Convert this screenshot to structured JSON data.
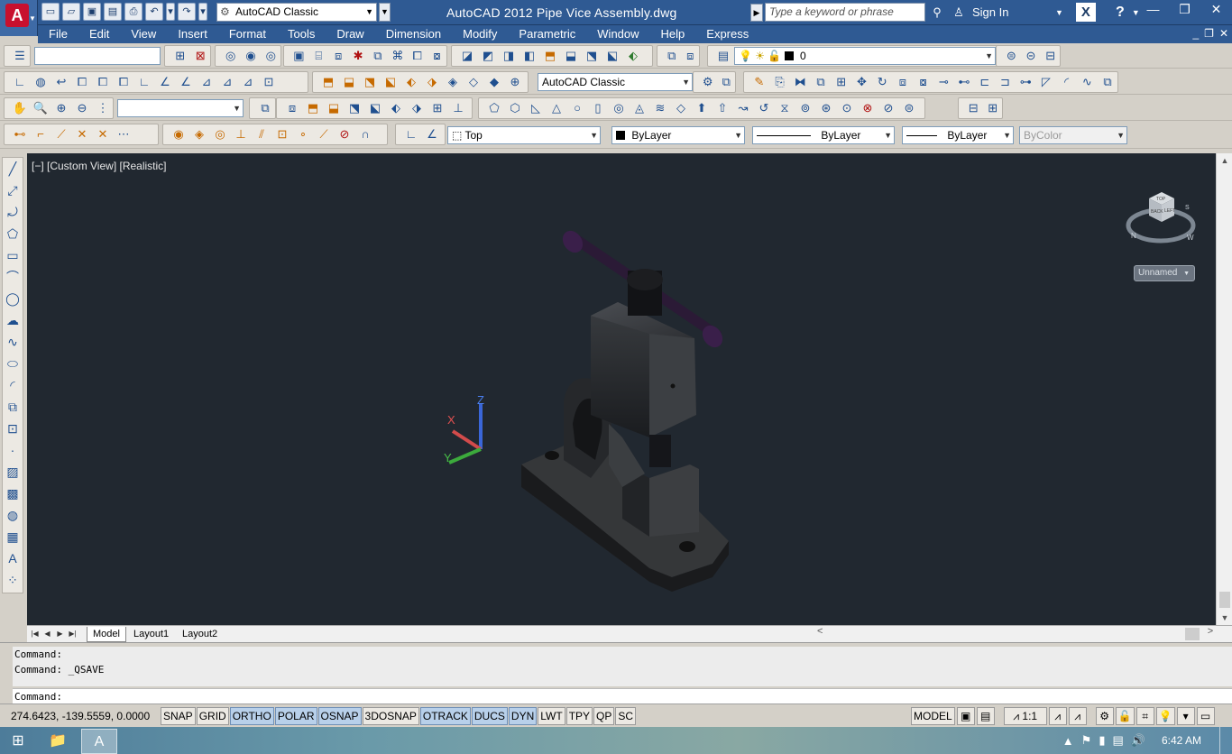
{
  "title_bar": {
    "workspace": "AutoCAD Classic",
    "document_title": "AutoCAD 2012    Pipe Vice Assembly.dwg",
    "search_placeholder": "Type a keyword or phrase",
    "sign_in": "Sign In",
    "app_logo": "A"
  },
  "menu": [
    "File",
    "Edit",
    "View",
    "Insert",
    "Format",
    "Tools",
    "Draw",
    "Dimension",
    "Modify",
    "Parametric",
    "Window",
    "Help",
    "Express"
  ],
  "toolbars": {
    "layer_value": "0",
    "workspace_combo": "AutoCAD Classic",
    "view_combo": "Top",
    "color_combo": "ByLayer",
    "linetype_combo": "ByLayer",
    "lineweight_combo": "ByLayer",
    "plotstyle_combo": "ByColor"
  },
  "viewport": {
    "label": "[−] [Custom View] [Realistic]",
    "viewcube_top": "TOP",
    "viewcube_front": "BACK",
    "viewcube_right": "LEFT",
    "compass_n": "N",
    "compass_w": "W",
    "compass_s": "S",
    "ucs_name": "Unnamed",
    "ucs_axes": {
      "x": "X",
      "y": "Y",
      "z": "Z"
    }
  },
  "tabs": [
    "Model",
    "Layout1",
    "Layout2"
  ],
  "command": {
    "history": [
      "Command:",
      "Command: _QSAVE"
    ],
    "prompt": "Command:"
  },
  "status": {
    "coordinates": "274.6423, -139.5559, 0.0000",
    "toggles": [
      {
        "label": "SNAP",
        "on": false
      },
      {
        "label": "GRID",
        "on": false
      },
      {
        "label": "ORTHO",
        "on": true
      },
      {
        "label": "POLAR",
        "on": true
      },
      {
        "label": "OSNAP",
        "on": true
      },
      {
        "label": "3DOSNAP",
        "on": false
      },
      {
        "label": "OTRACK",
        "on": true
      },
      {
        "label": "DUCS",
        "on": true
      },
      {
        "label": "DYN",
        "on": true
      },
      {
        "label": "LWT",
        "on": false
      },
      {
        "label": "TPY",
        "on": false
      },
      {
        "label": "QP",
        "on": false
      },
      {
        "label": "SC",
        "on": false
      }
    ],
    "model_label": "MODEL",
    "annotation_scale": "1:1"
  },
  "taskbar": {
    "time": "6:42 AM"
  },
  "colors": {
    "title_blue": "#2f5a93",
    "viewport_bg": "#212830",
    "toggle_on": "#b8d0ea"
  }
}
